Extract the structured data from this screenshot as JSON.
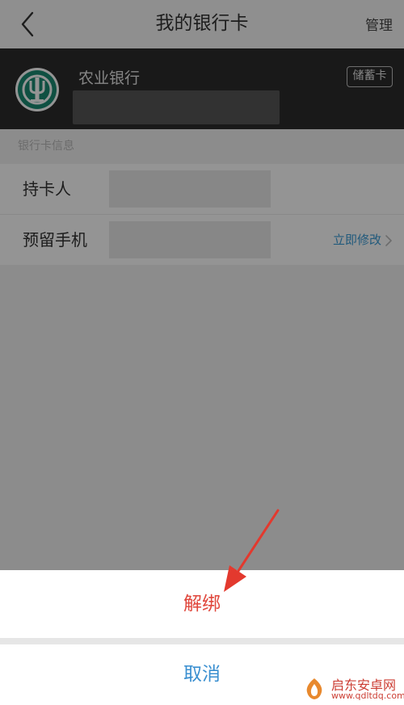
{
  "header": {
    "title": "我的银行卡",
    "action_label": "管理",
    "back_icon": "chevron-left-icon"
  },
  "bank_card": {
    "bank_name": "农业银行",
    "card_type": "储蓄卡",
    "logo_icon": "abc-bank-logo-icon"
  },
  "card_info": {
    "section_label": "银行卡信息",
    "rows": [
      {
        "label": "持卡人"
      },
      {
        "label": "预留手机",
        "action_label": "立即修改"
      }
    ]
  },
  "action_sheet": {
    "primary_label": "解绑",
    "cancel_label": "取消"
  },
  "watermark": {
    "name": "启东安卓网",
    "url": "www.qdltdq.com"
  },
  "colors": {
    "destructive": "#e0473c",
    "link": "#3a9bd6",
    "card_background": "#2b2b2b",
    "bank_logo": "#1a8a73"
  }
}
